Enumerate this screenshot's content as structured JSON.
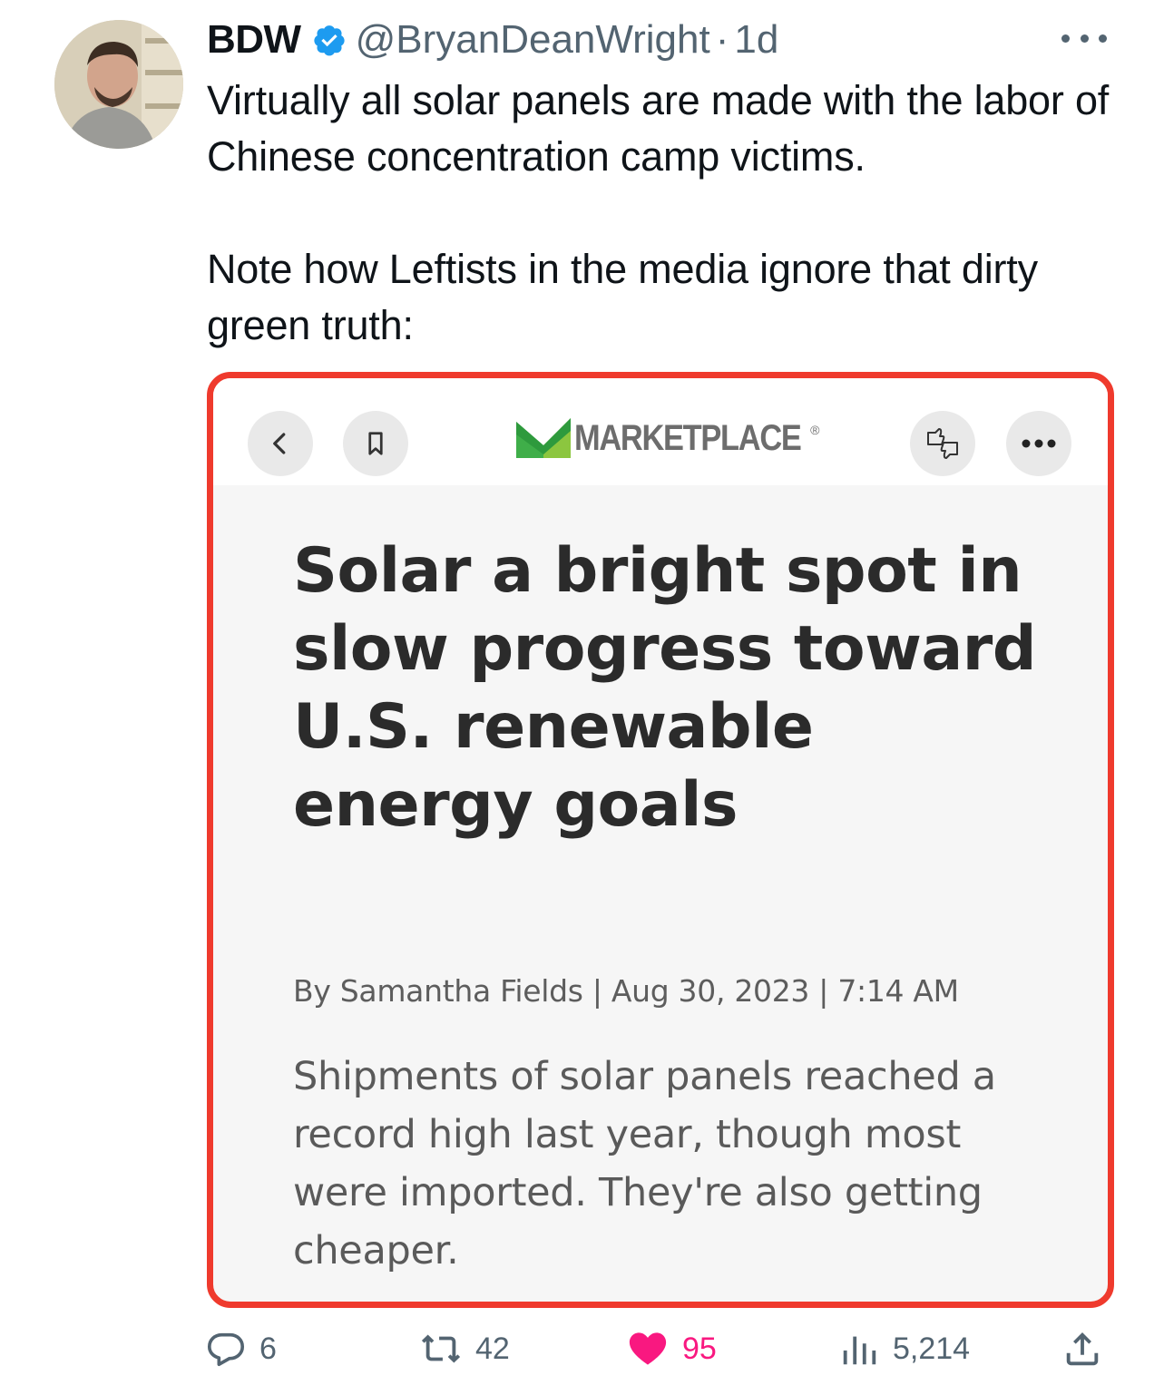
{
  "tweet": {
    "display_name": "BDW",
    "handle": "@BryanDeanWright",
    "separator": "·",
    "time": "1d",
    "text_paragraphs": [
      "Virtually all solar panels are made with the labor of Chinese concentration camp victims.",
      "Note how Leftists in the media ignore that dirty green truth:"
    ]
  },
  "embedded_article": {
    "brand": "MARKETPLACE",
    "brand_mark": "®",
    "headline": "Solar a bright spot in slow progress toward U.S. renewable energy goals",
    "byline": "By Samantha Fields | Aug 30, 2023 | 7:14 AM",
    "summary": "Shipments of solar panels reached a record high last year, though most were imported. They're also getting cheaper.",
    "icons": [
      "back-icon",
      "bookmark-icon",
      "thumbs-feedback-icon",
      "more-icon"
    ]
  },
  "actions": {
    "replies": "6",
    "reposts": "42",
    "likes": "95",
    "views": "5,214"
  },
  "colors": {
    "verified": "#1d9bf0",
    "highlight_border": "#ef3a2d",
    "like": "#f91880",
    "secondary_text": "#536471",
    "logo_green": "#3fae49"
  }
}
